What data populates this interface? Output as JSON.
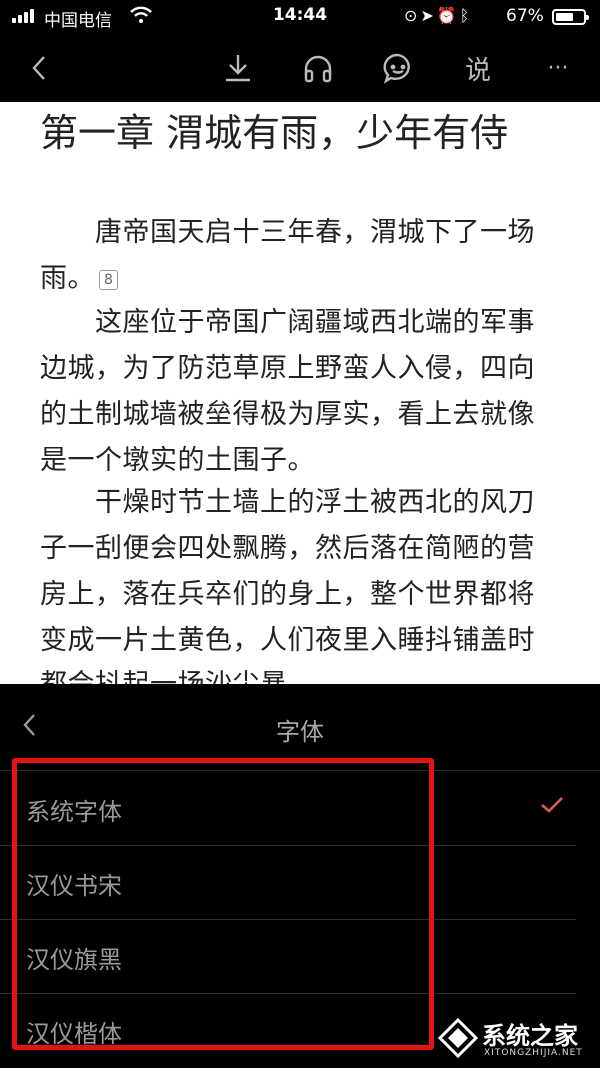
{
  "status_bar": {
    "carrier": "中国电信",
    "time": "14:44",
    "battery": "67%",
    "battery_level": 0.67
  },
  "toolbar": {
    "say_label": "说",
    "more_label": "···"
  },
  "chapter": {
    "title": "第一章 渭城有雨，少年有侍",
    "lines": [
      "　　唐帝国天启十三年春，渭城下了一场",
      "雨。",
      "　　这座位于帝国广阔疆域西北端的军事",
      "边城，为了防范草原上野蛮人入侵，四向",
      "的土制城墙被垒得极为厚实，看上去就像",
      "是一个墩实的土围子。",
      "　　干燥时节土墙上的浮土被西北的风刀",
      "子一刮便会四处飘腾，然后落在简陋的营",
      "房上，落在兵卒们的身上，整个世界都将",
      "变成一片土黄色，人们夜里入睡抖铺盖时",
      "都会抖起一场沙尘暴。"
    ],
    "note_count": "8"
  },
  "font_panel": {
    "title": "字体",
    "fonts": [
      {
        "label": "系统字体",
        "selected": true
      },
      {
        "label": "汉仪书宋",
        "selected": false
      },
      {
        "label": "汉仪旗黑",
        "selected": false
      },
      {
        "label": "汉仪楷体",
        "selected": false
      }
    ]
  },
  "watermark": {
    "name": "系统之家",
    "site": "XITONGZHIJIA.NET"
  },
  "colors": {
    "accent": "#e05a5a",
    "highlight": "#e01414"
  }
}
